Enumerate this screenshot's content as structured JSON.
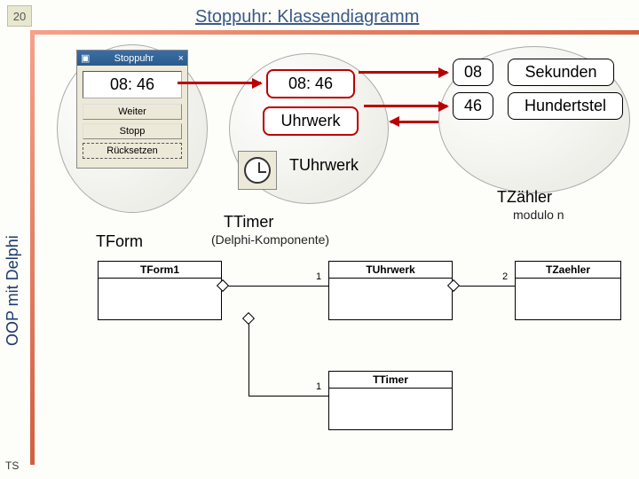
{
  "page_number": "20",
  "title": "Stoppuhr: Klassendiagramm",
  "sidebar": "OOP mit Delphi",
  "footer": "TS",
  "window": {
    "title": "Stoppuhr",
    "display": "08: 46",
    "btn_weiter": "Weiter",
    "btn_stopp": "Stopp",
    "btn_reset": "Rücksetzen"
  },
  "center": {
    "time": "08: 46",
    "uhrwerk": "Uhrwerk",
    "tuhrwerk": "TUhrwerk",
    "ttimer": "TTimer",
    "ttimer_sub": "(Delphi-Komponente)",
    "tform": "TForm"
  },
  "right": {
    "seconds_val": "08",
    "seconds_lbl": "Sekunden",
    "hund_val": "46",
    "hund_lbl": "Hundertstel",
    "tzaehler": "TZähler",
    "modulo": "modulo n"
  },
  "uml": {
    "tform1": "TForm1",
    "tuhrwerk": "TUhrwerk",
    "tzaehler": "TZaehler",
    "ttimer": "TTimer",
    "one_a": "1",
    "one_b": "1",
    "two": "2"
  }
}
